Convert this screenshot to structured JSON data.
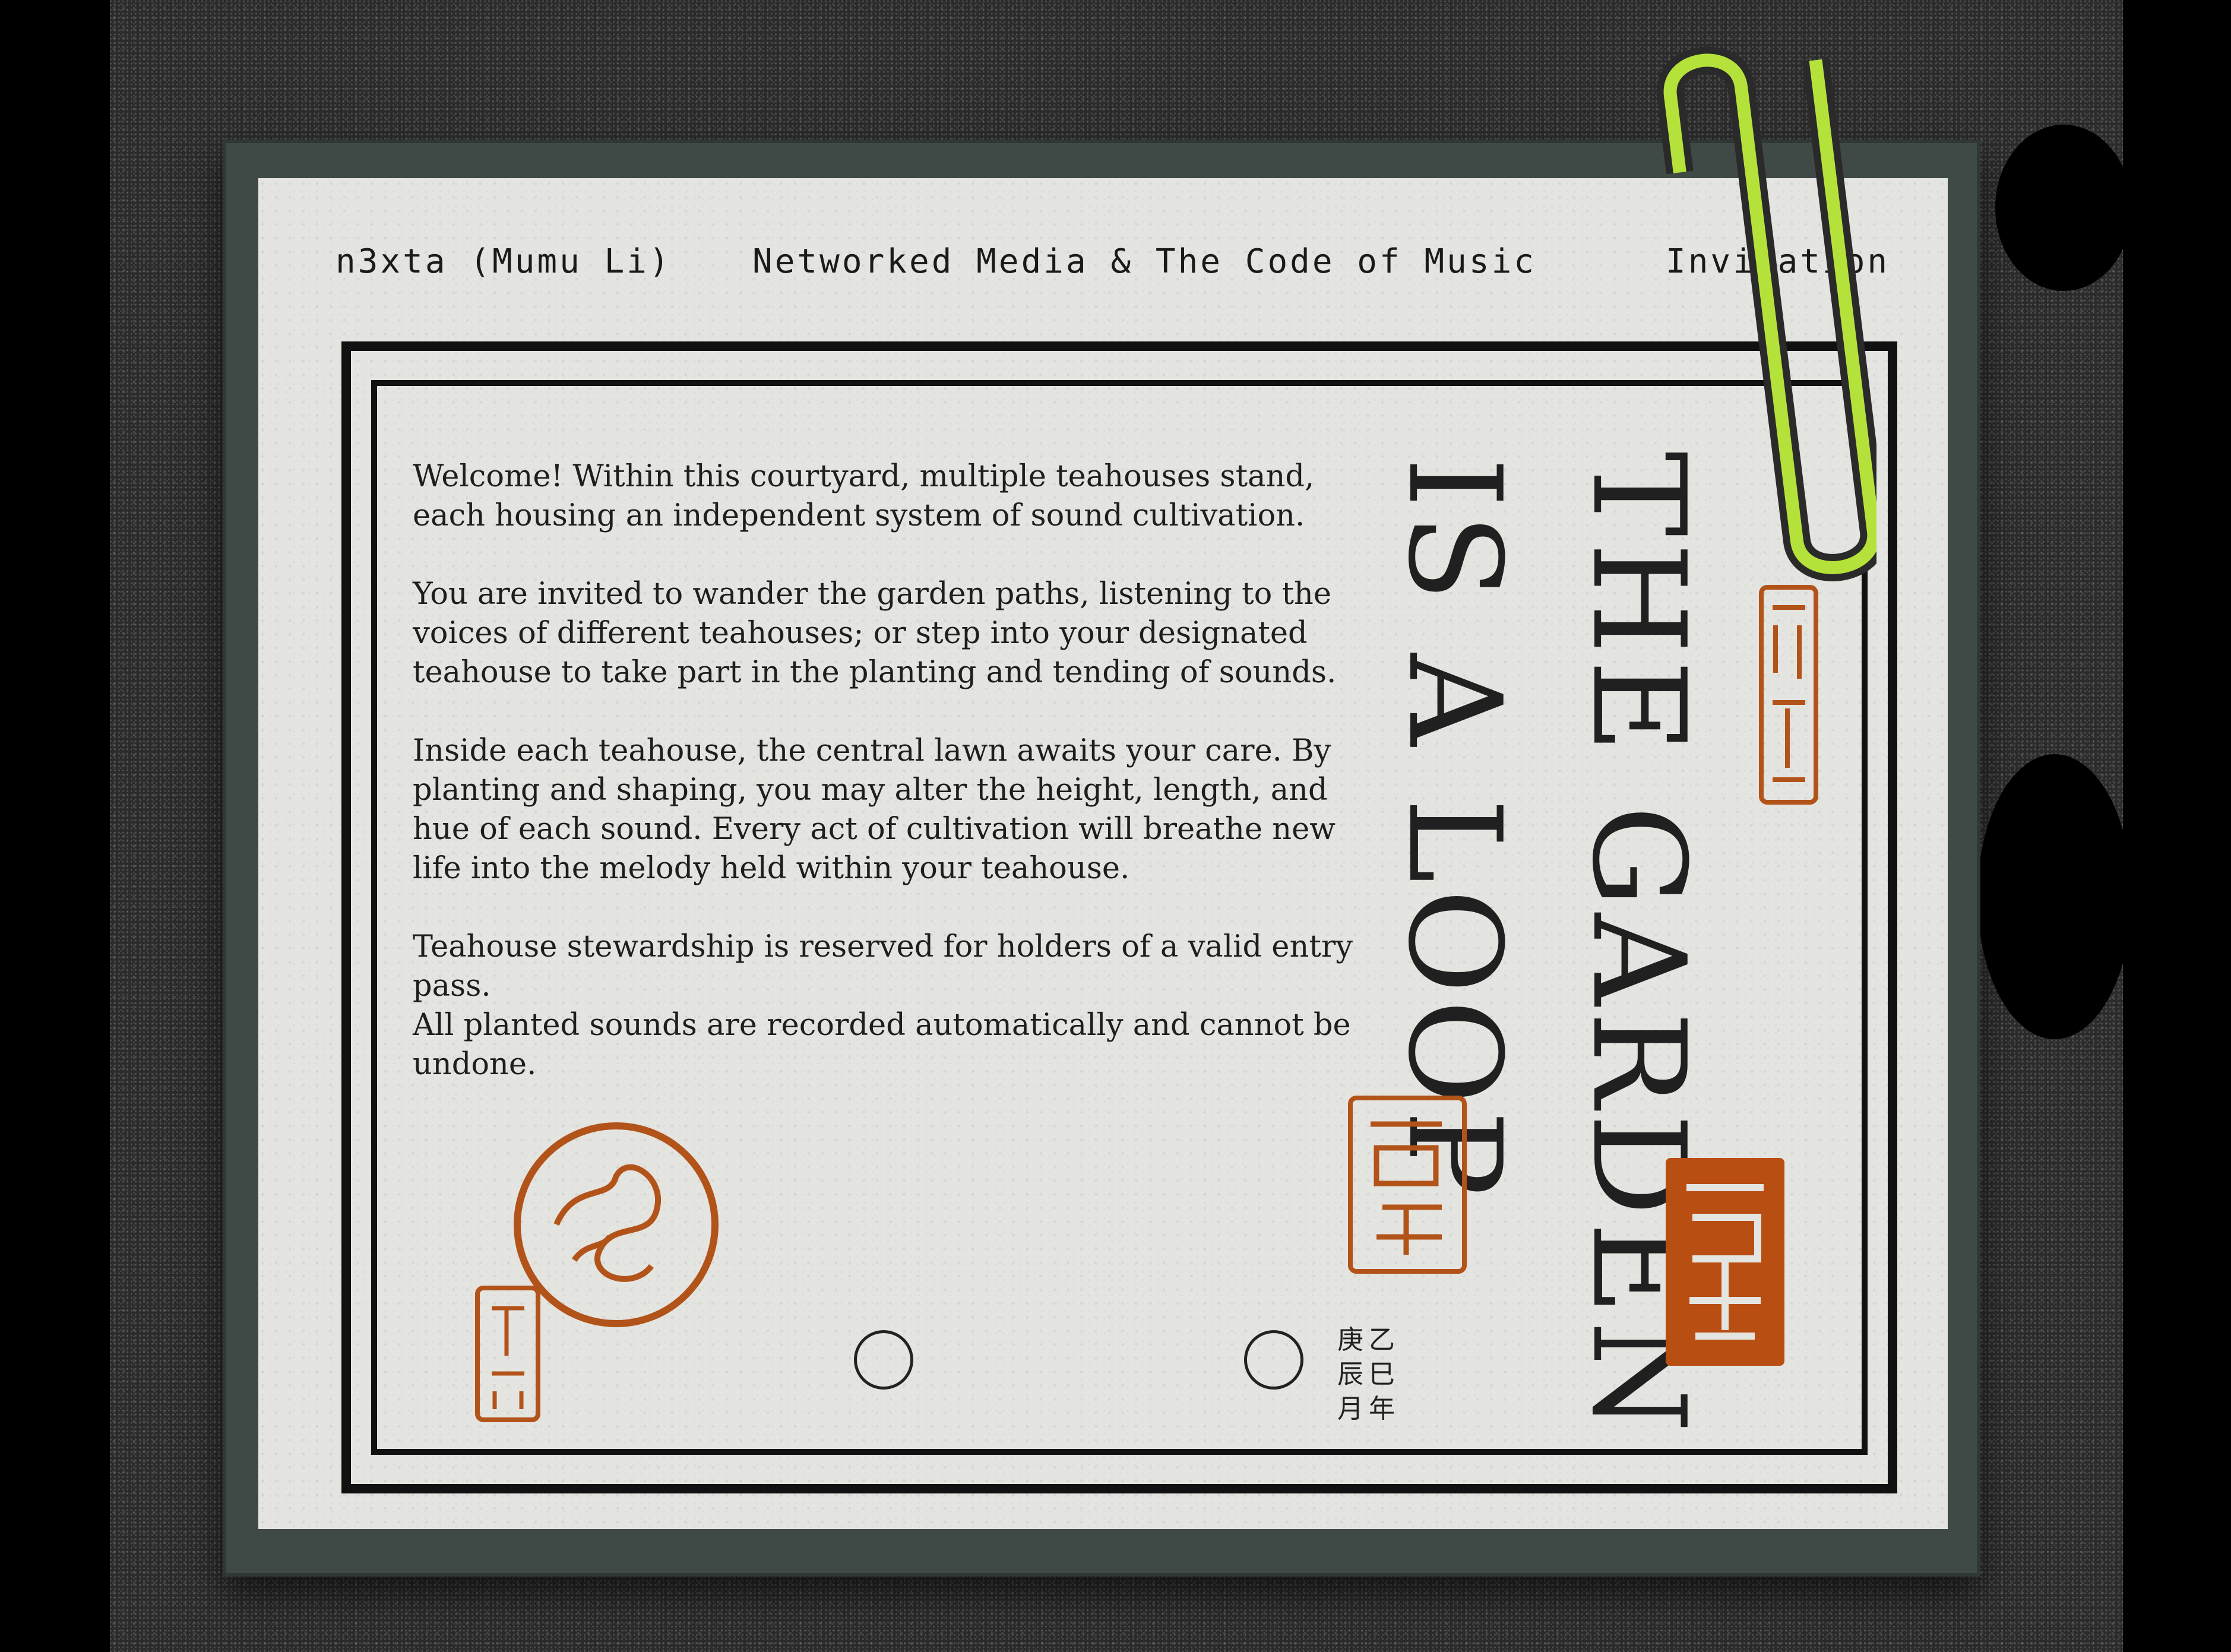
{
  "header": {
    "author": "n3xta (Mumu Li)",
    "course": "Networked Media & The Code of Music",
    "label": "Invitation"
  },
  "body": {
    "paragraphs": [
      "Welcome! Within this courtyard, multiple teahouses stand, each housing an independent system of sound cultivation.",
      "You are invited to wander the garden paths, listening to the voices of different teahouses; or step into your designated teahouse to take part in the planting and tending of sounds.",
      "Inside each teahouse, the central lawn awaits your care. By planting and shaping, you may alter the height, length, and hue of each sound. Every act of cultivation will breathe new life into the melody held within your teahouse.",
      "Teahouse stewardship is reserved for holders of a valid entry pass.",
      "All planted sounds are recorded automatically and cannot be undone."
    ]
  },
  "title": {
    "line1": "THE GARDEN",
    "line2": "IS A LOOP"
  },
  "date": {
    "col_left": [
      "庚",
      "辰",
      "月"
    ],
    "col_right": [
      "乙",
      "巳",
      "年"
    ]
  },
  "colors": {
    "paper": "#e4e4e0",
    "ink": "#1e1e1e",
    "seal": "#b2531a",
    "clip": "#b5e23a",
    "backing": "#3f4a46"
  }
}
